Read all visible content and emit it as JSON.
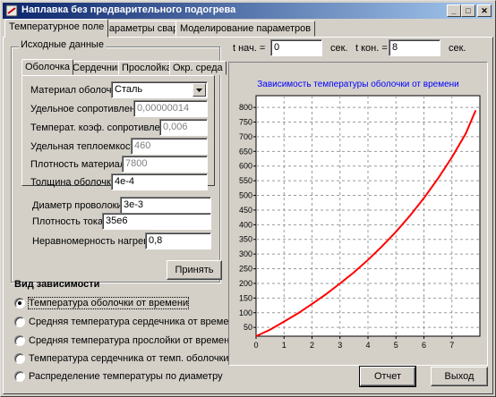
{
  "window": {
    "title": "Наплавка без предварительного подогрева",
    "minimize": "_",
    "maximize": "□",
    "close": "✕"
  },
  "tabs": [
    "Температурное поле",
    "Параметры сварки",
    "Моделирование параметров"
  ],
  "source": {
    "group_label": "Исходные данные",
    "subtabs": [
      "Оболочка",
      "Сердечник",
      "Прослойка",
      "Окр. среда"
    ],
    "material_label": "Материал оболочки:",
    "material_value": "Сталь",
    "resistivity_label": "Удельное сопротивление",
    "resistivity_value": "0,00000014",
    "temp_coef_label": "Температ. коэф. сопротивления",
    "temp_coef_value": "0,006",
    "heat_capacity_label": "Удельная теплоемкость",
    "heat_capacity_value": "460",
    "density_label": "Плотность материала",
    "density_value": "7800",
    "thickness_label": "Толщина оболочки",
    "thickness_value": "4e-4",
    "wire_diameter_label": "Диаметр проволоки",
    "wire_diameter_value": "3e-3",
    "current_density_label": "Плотность тока",
    "current_density_value": "35e6",
    "nonuniformity_label": "Неравномерность нагрева",
    "nonuniformity_value": "0,8"
  },
  "apply_button": "Принять",
  "dependency": {
    "title": "Вид зависимости",
    "options": [
      "Температура оболочки от времени",
      "Средняя температура сердечника от времени",
      "Средняя температура прослойки от времени",
      "Температура сердечника от темп. оболочки",
      "Распределение температуры по диаметру"
    ],
    "selected": 0
  },
  "time": {
    "start_label": "t нач. =",
    "start_value": "0",
    "start_unit": "сек.",
    "end_label": "t кон. =",
    "end_value": "8",
    "end_unit": "сек."
  },
  "buttons": {
    "report": "Отчет",
    "exit": "Выход"
  },
  "colors": {
    "curve": "#ff0000",
    "chart_title": "#0000ff",
    "title_start": "#0a246a",
    "title_end": "#a6caf0"
  },
  "chart_data": {
    "type": "line",
    "title": "Зависимость температуры оболочки от времени",
    "xlabel": "",
    "ylabel": "",
    "xlim": [
      0,
      8
    ],
    "ylim": [
      20,
      840
    ],
    "xticks": [
      0,
      1,
      2,
      3,
      4,
      5,
      6,
      7
    ],
    "yticks": [
      50,
      100,
      150,
      200,
      250,
      300,
      350,
      400,
      450,
      500,
      550,
      600,
      650,
      700,
      750,
      800
    ],
    "grid": true,
    "series": [
      {
        "color": "#ff0000",
        "x": [
          0,
          0.5,
          1,
          1.5,
          2,
          2.5,
          3,
          3.5,
          4,
          4.5,
          5,
          5.5,
          6,
          6.5,
          7,
          7.5,
          7.85
        ],
        "y": [
          20,
          42,
          70,
          98,
          130,
          163,
          200,
          238,
          280,
          326,
          376,
          431,
          491,
          557,
          630,
          712,
          790
        ]
      }
    ]
  }
}
